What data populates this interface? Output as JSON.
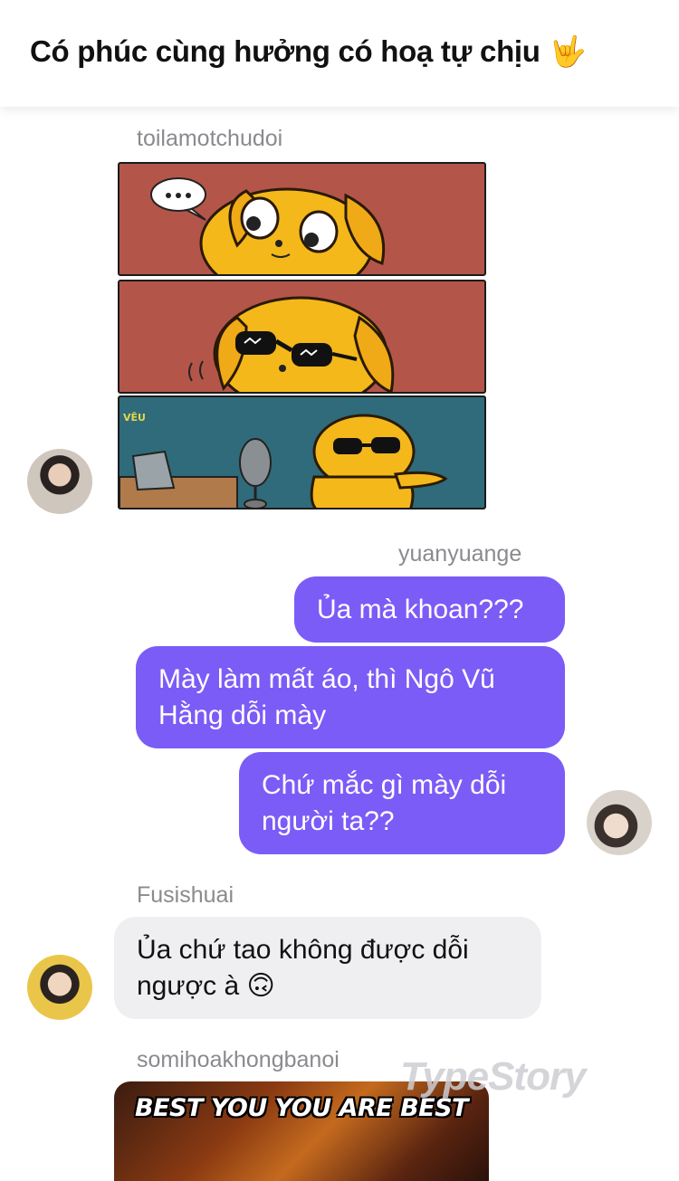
{
  "header": {
    "title": "Có phúc cùng hưởng có hoạ tự chịu",
    "emoji": "🤟"
  },
  "messages": [
    {
      "sender": "toilamotchudoi",
      "type": "image",
      "image_icon": "dog-comic-image"
    },
    {
      "sender": "yuanyuange",
      "type": "text",
      "direction": "out",
      "bubbles": [
        "Ủa mà khoan???",
        "Mày làm mất áo, thì Ngô Vũ Hằng dỗi mày",
        "Chứ mắc gì mày dỗi người ta??"
      ]
    },
    {
      "sender": "Fusishuai",
      "type": "text",
      "direction": "in",
      "bubbles": [
        "Ủa chứ tao không được dỗi ngược à 🙃"
      ]
    },
    {
      "sender": "somihoakhongbanoi",
      "type": "image",
      "image_caption": "BEST YOU YOU ARE BEST"
    }
  ],
  "watermark": "TypeStory",
  "colors": {
    "outgoing_bubble": "#7b5cf6",
    "incoming_bubble": "#efeff2",
    "username": "#8a8a8f"
  }
}
